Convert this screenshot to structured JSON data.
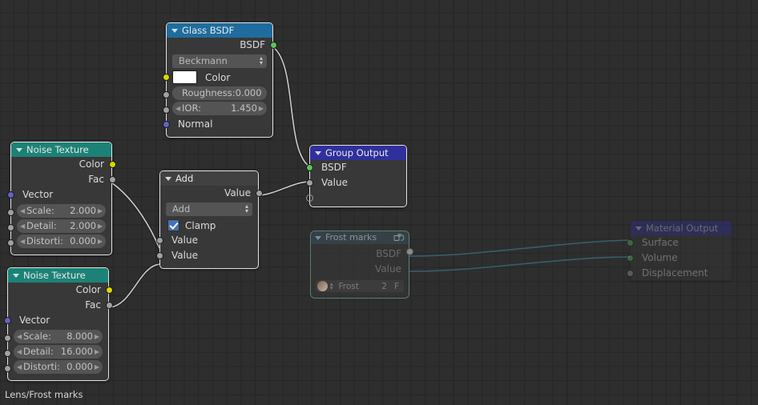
{
  "editor": {
    "name": "blender-shader-node-editor",
    "background_color": "#2e2e2e",
    "grid_color": "#262626",
    "breadcrumb": "Lens/Frost marks"
  },
  "nodes": {
    "glass_bsdf": {
      "title": "Glass BSDF",
      "header_color": "#1f6d9e",
      "outputs": [
        {
          "label": "BSDF",
          "socket": "green"
        }
      ],
      "distribution": "Beckmann",
      "color_label": "Color",
      "color_value": "#ffffff",
      "roughness_label": "Roughness:",
      "roughness_value": "0.000",
      "ior_label": "IOR:",
      "ior_value": "1.450",
      "normal_label": "Normal"
    },
    "noise_top": {
      "title": "Noise Texture",
      "header_color": "#1c8277",
      "outputs": [
        {
          "label": "Color",
          "socket": "yellow"
        },
        {
          "label": "Fac",
          "socket": "grey"
        }
      ],
      "vector_label": "Vector",
      "scale_label": "Scale:",
      "scale_value": "2.000",
      "detail_label": "Detail:",
      "detail_value": "2.000",
      "distortion_label": "Distorti:",
      "distortion_value": "0.000"
    },
    "noise_bottom": {
      "title": "Noise Texture",
      "header_color": "#1c8277",
      "outputs": [
        {
          "label": "Color",
          "socket": "yellow"
        },
        {
          "label": "Fac",
          "socket": "grey"
        }
      ],
      "vector_label": "Vector",
      "scale_label": "Scale:",
      "scale_value": "8.000",
      "detail_label": "Detail:",
      "detail_value": "16.000",
      "distortion_label": "Distorti:",
      "distortion_value": "0.000"
    },
    "math_add": {
      "title": "Add",
      "header_color": "#3f3f3f",
      "output_label": "Value",
      "operation": "Add",
      "clamp_label": "Clamp",
      "clamp_checked": true,
      "input_a_label": "Value",
      "input_b_label": "Value"
    },
    "group_output": {
      "title": "Group Output",
      "header_color": "#30309c",
      "inputs": [
        {
          "label": "BSDF",
          "socket": "green"
        },
        {
          "label": "Value",
          "socket": "grey"
        },
        {
          "label": "",
          "socket": "empty"
        }
      ]
    },
    "frost_marks_group": {
      "title": "Frost marks",
      "outputs": [
        {
          "label": "BSDF",
          "socket": "green"
        },
        {
          "label": "Value",
          "socket": "grey"
        }
      ],
      "datablock_name": "Frost",
      "users_count": "2",
      "unlink_label": "F"
    },
    "material_output": {
      "title": "Material Output",
      "header_color": "#30309c",
      "inputs": [
        {
          "label": "Surface",
          "socket": "green"
        },
        {
          "label": "Volume",
          "socket": "green"
        },
        {
          "label": "Displacement",
          "socket": "grey"
        }
      ]
    }
  },
  "links": [
    {
      "from": "glass_bsdf.BSDF",
      "to": "group_output.BSDF"
    },
    {
      "from": "noise_top.Fac",
      "to": "math_add.Value_A"
    },
    {
      "from": "noise_bottom.Fac",
      "to": "math_add.Value_B"
    },
    {
      "from": "math_add.Value",
      "to": "group_output.Value"
    },
    {
      "from": "frost_marks_group.BSDF",
      "to": "material_output.Surface"
    },
    {
      "from": "frost_marks_group.Value",
      "to": "material_output.Volume"
    }
  ],
  "colors": {
    "socket_green": "#5ac45a",
    "socket_grey": "#a1a1a1",
    "socket_yellow": "#d8d800",
    "socket_blue": "#6363c7",
    "link_grey": "#c3c3c3",
    "link_ghost": "#3e6f82"
  }
}
